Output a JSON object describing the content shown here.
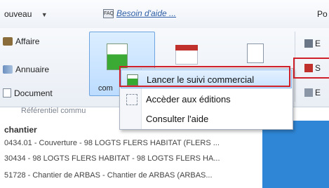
{
  "topbar": {
    "nouveau": "ouveau",
    "help_text": "Besoin d'aide ...",
    "right_fragment": "Po"
  },
  "ribbon": {
    "left_items": [
      "Affaire",
      "Annuaire",
      "Document"
    ],
    "selected_caption": "com",
    "group_label": "Référentiel commu",
    "right_items": [
      "E",
      "S",
      "E"
    ]
  },
  "context_menu": {
    "items": [
      {
        "label": "Lancer le suivi commercial",
        "icon": "suivi-icon",
        "highlighted": true
      },
      {
        "label": "Accèder aux éditions",
        "icon": "editions-icon"
      },
      {
        "label": "Consulter l'aide",
        "icon": ""
      }
    ]
  },
  "list": {
    "header": "chantier",
    "rows": [
      "0434.01 - Couverture - 98 LOGTS FLERS HABITAT (FLERS ...",
      "30434 - 98 LOGTS FLERS HABITAT - 98 LOGTS FLERS HA...",
      "51728 - Chantier de ARBAS - Chantier de ARBAS (ARBAS..."
    ]
  },
  "colors": {
    "highlight_border": "#d0202a",
    "selected_bg": "#bcdcff",
    "link": "#2f5fa6"
  }
}
